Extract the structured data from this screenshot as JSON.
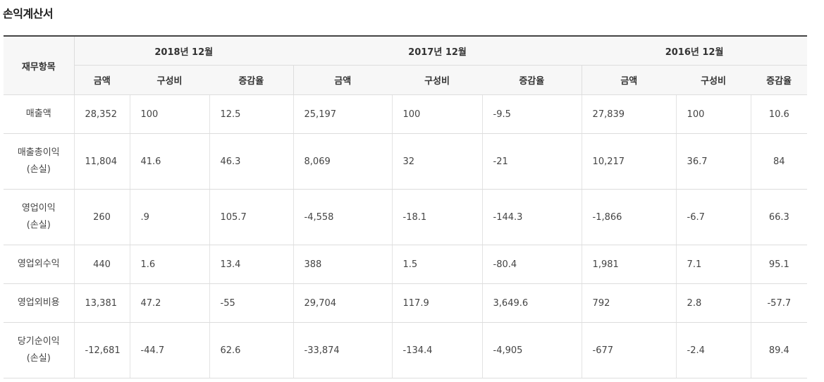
{
  "title": "손익계산서",
  "header": {
    "item_label": "재무항목",
    "periods": [
      "2018년 12월",
      "2017년 12월",
      "2016년 12월"
    ],
    "sub_columns": [
      "금액",
      "구성비",
      "증감율"
    ]
  },
  "rows": [
    {
      "label_line1": "매출액",
      "label_line2": "",
      "cells": [
        "28,352",
        "100",
        "12.5",
        "25,197",
        "100",
        "-9.5",
        "27,839",
        "100",
        "10.6"
      ]
    },
    {
      "label_line1": "매출총이익",
      "label_line2": "(손실)",
      "cells": [
        "11,804",
        "41.6",
        "46.3",
        "8,069",
        "32",
        "-21",
        "10,217",
        "36.7",
        "84"
      ]
    },
    {
      "label_line1": "영업이익",
      "label_line2": "(손실)",
      "cells": [
        "260",
        ".9",
        "105.7",
        "-4,558",
        "-18.1",
        "-144.3",
        "-1,866",
        "-6.7",
        "66.3"
      ]
    },
    {
      "label_line1": "영업외수익",
      "label_line2": "",
      "cells": [
        "440",
        "1.6",
        "13.4",
        "388",
        "1.5",
        "-80.4",
        "1,981",
        "7.1",
        "95.1"
      ]
    },
    {
      "label_line1": "영업외비용",
      "label_line2": "",
      "cells": [
        "13,381",
        "47.2",
        "-55",
        "29,704",
        "117.9",
        "3,649.6",
        "792",
        "2.8",
        "-57.7"
      ]
    },
    {
      "label_line1": "당기순이익",
      "label_line2": "(손실)",
      "cells": [
        "-12,681",
        "-44.7",
        "62.6",
        "-33,874",
        "-134.4",
        "-4,905",
        "-677",
        "-2.4",
        "89.4"
      ]
    }
  ]
}
